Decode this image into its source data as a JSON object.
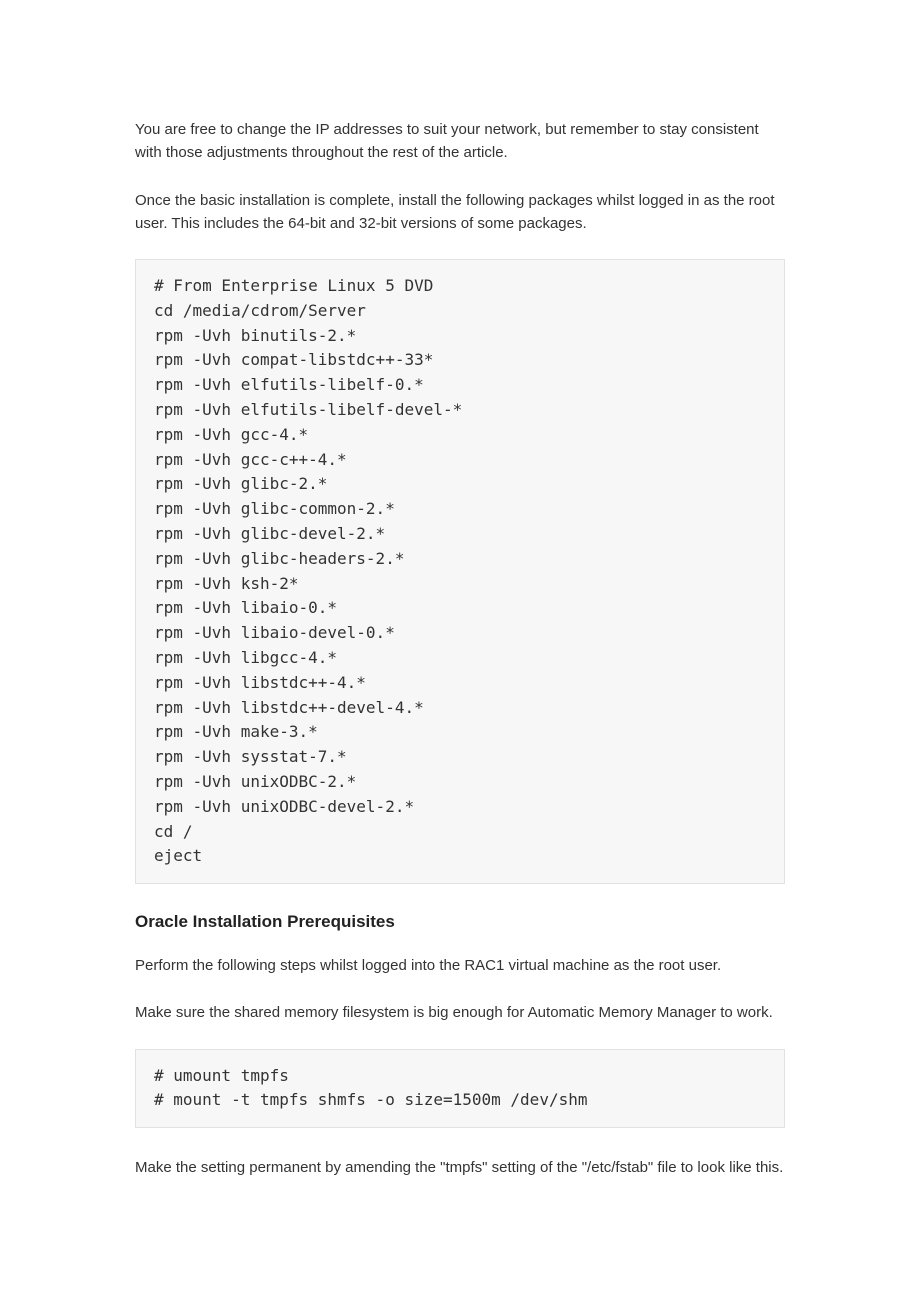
{
  "paragraphs": {
    "p1": "You are free to change the IP addresses to suit your network, but remember to stay consistent with those adjustments throughout the rest of the article.",
    "p2": "Once the basic installation is complete, install the following packages whilst logged in as the root user. This includes the 64-bit and 32-bit versions of some packages.",
    "p3": "Perform the following steps whilst logged into the RAC1 virtual machine as the root user.",
    "p4": "Make sure the shared memory filesystem is big enough for Automatic Memory Manager to work.",
    "p5": "Make the setting permanent by amending the \"tmpfs\" setting of the \"/etc/fstab\" file to look like this."
  },
  "heading": "Oracle Installation Prerequisites",
  "code1": "# From Enterprise Linux 5 DVD\ncd /media/cdrom/Server\nrpm -Uvh binutils-2.*\nrpm -Uvh compat-libstdc++-33*\nrpm -Uvh elfutils-libelf-0.*\nrpm -Uvh elfutils-libelf-devel-*\nrpm -Uvh gcc-4.*\nrpm -Uvh gcc-c++-4.*\nrpm -Uvh glibc-2.*\nrpm -Uvh glibc-common-2.*\nrpm -Uvh glibc-devel-2.*\nrpm -Uvh glibc-headers-2.*\nrpm -Uvh ksh-2*\nrpm -Uvh libaio-0.*\nrpm -Uvh libaio-devel-0.*\nrpm -Uvh libgcc-4.*\nrpm -Uvh libstdc++-4.*\nrpm -Uvh libstdc++-devel-4.*\nrpm -Uvh make-3.*\nrpm -Uvh sysstat-7.*\nrpm -Uvh unixODBC-2.*\nrpm -Uvh unixODBC-devel-2.*\ncd /\neject",
  "code2": "# umount tmpfs\n# mount -t tmpfs shmfs -o size=1500m /dev/shm"
}
